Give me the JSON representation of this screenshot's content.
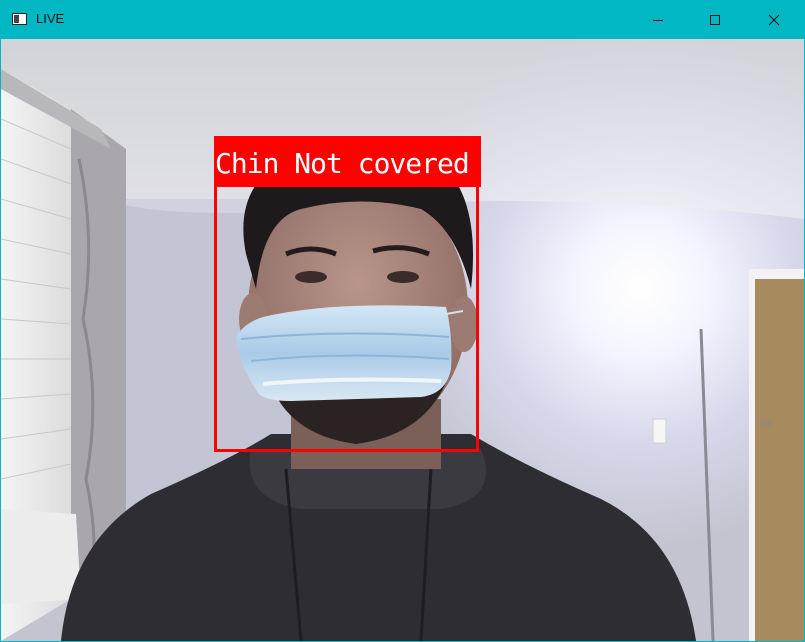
{
  "window": {
    "title": "LIVE",
    "accent_color": "#00b7c3",
    "controls": [
      {
        "name": "minimize",
        "icon": "minimize-icon"
      },
      {
        "name": "maximize",
        "icon": "maximize-icon"
      },
      {
        "name": "close",
        "icon": "close-icon"
      }
    ]
  },
  "detection": {
    "label": "Chin Not covered",
    "box_color": "#ff0000",
    "label_text_color": "#ffffff"
  }
}
